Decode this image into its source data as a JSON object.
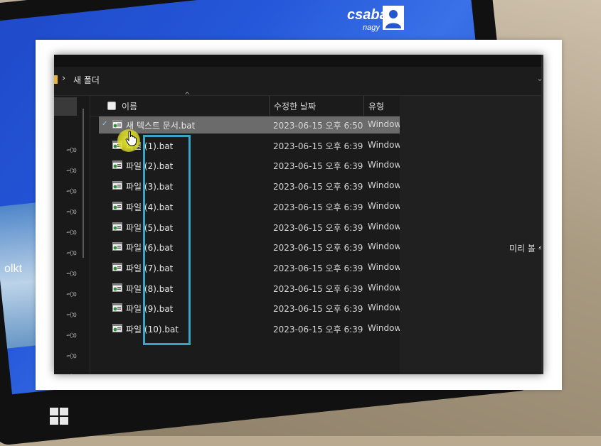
{
  "desktop": {
    "user_name": "csaba",
    "user_sub": "nagy",
    "tile_text": "olkt"
  },
  "explorer": {
    "breadcrumb": "새 폴더",
    "columns": {
      "name": "이름",
      "date": "수정한 날짜",
      "type": "유형"
    },
    "files": [
      {
        "name": "새 텍스트 문서.bat",
        "date": "2023-06-15 오후 6:50",
        "type": "Windows",
        "selected": true
      },
      {
        "name": "파일 (1).bat",
        "date": "2023-06-15 오후 6:39",
        "type": "Windows"
      },
      {
        "name": "파일 (2).bat",
        "date": "2023-06-15 오후 6:39",
        "type": "Windows"
      },
      {
        "name": "파일 (3).bat",
        "date": "2023-06-15 오후 6:39",
        "type": "Windows"
      },
      {
        "name": "파일 (4).bat",
        "date": "2023-06-15 오후 6:39",
        "type": "Windows"
      },
      {
        "name": "파일 (5).bat",
        "date": "2023-06-15 오후 6:39",
        "type": "Windows"
      },
      {
        "name": "파일 (6).bat",
        "date": "2023-06-15 오후 6:39",
        "type": "Windows"
      },
      {
        "name": "파일 (7).bat",
        "date": "2023-06-15 오후 6:39",
        "type": "Windows"
      },
      {
        "name": "파일 (8).bat",
        "date": "2023-06-15 오후 6:39",
        "type": "Windows"
      },
      {
        "name": "파일 (9).bat",
        "date": "2023-06-15 오후 6:39",
        "type": "Windows"
      },
      {
        "name": "파일 (10).bat",
        "date": "2023-06-15 오후 6:39",
        "type": "Windows"
      }
    ],
    "preview_text": "미리 볼 수",
    "accent": "#3aa4c4"
  }
}
